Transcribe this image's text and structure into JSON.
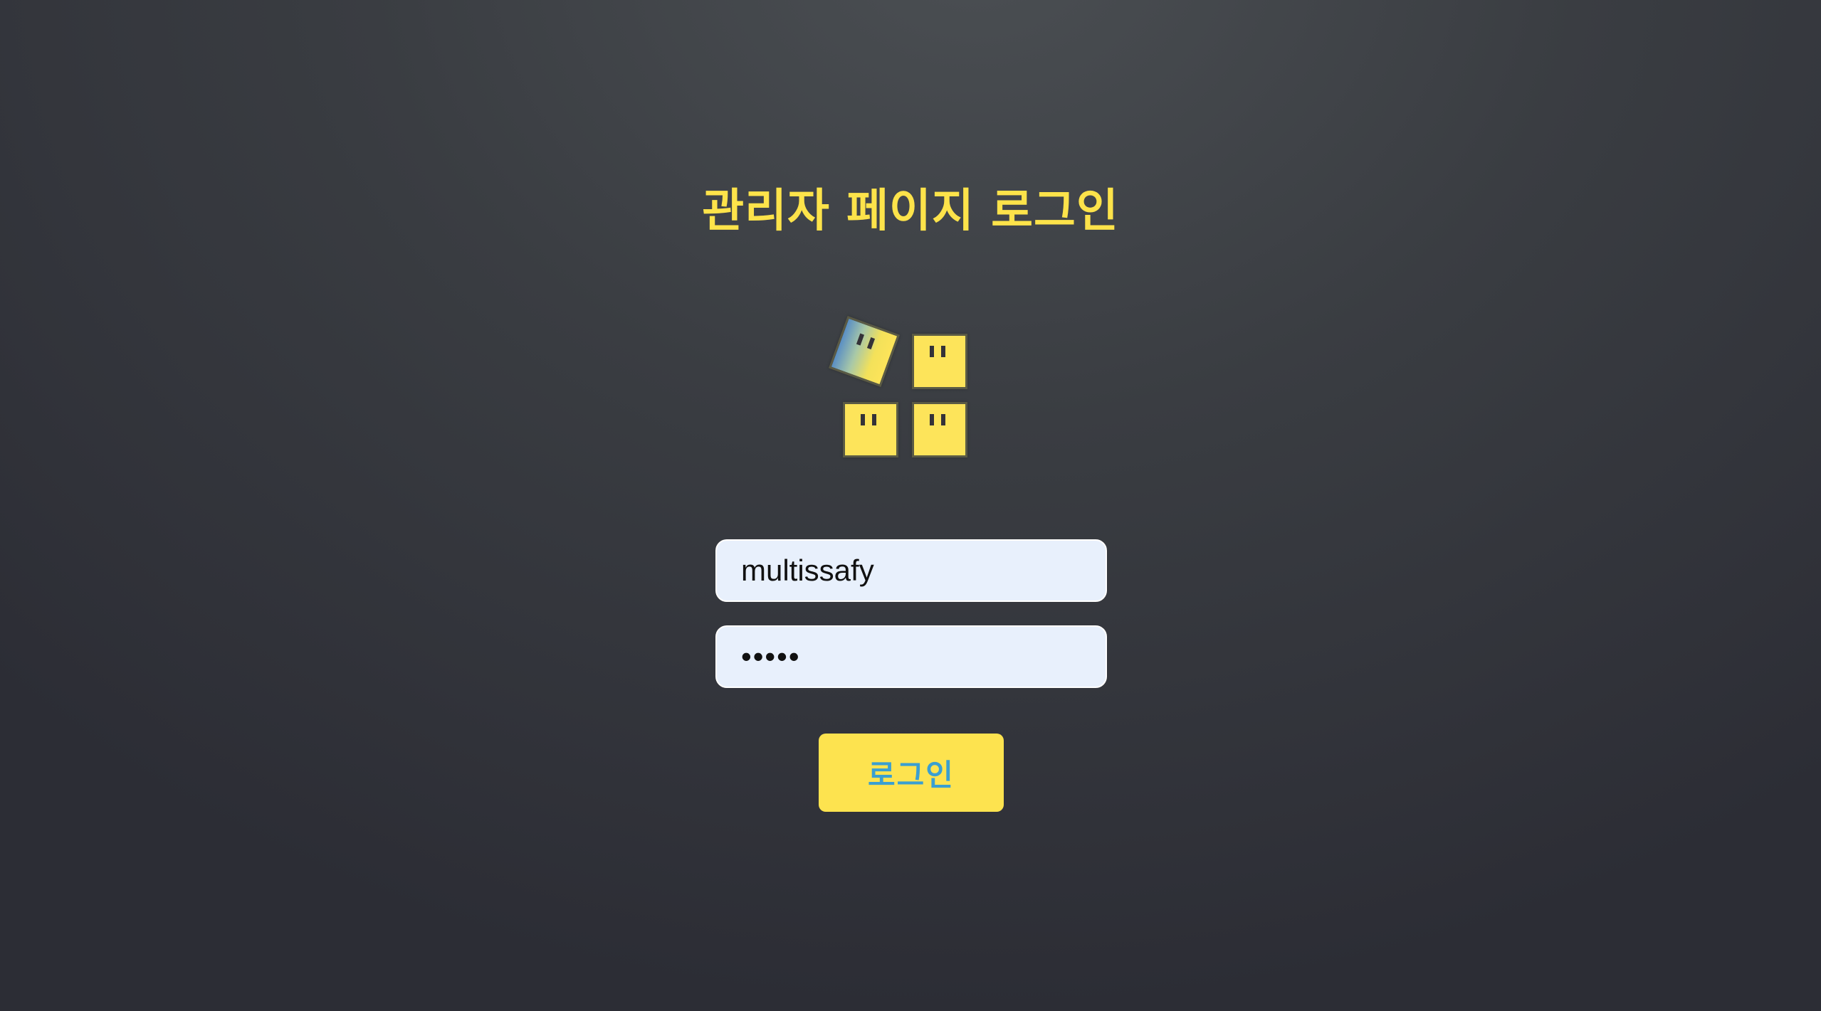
{
  "page": {
    "title": "관리자 페이지 로그인"
  },
  "logo": {
    "icon": "four-yellow-box-faces-logo"
  },
  "form": {
    "username_value": "multissafy",
    "password_value": "•••••",
    "login_label": "로그인"
  },
  "colors": {
    "accent": "#fde34a",
    "button_text": "#3a9fd1",
    "input_bg": "#e8f0fc"
  }
}
